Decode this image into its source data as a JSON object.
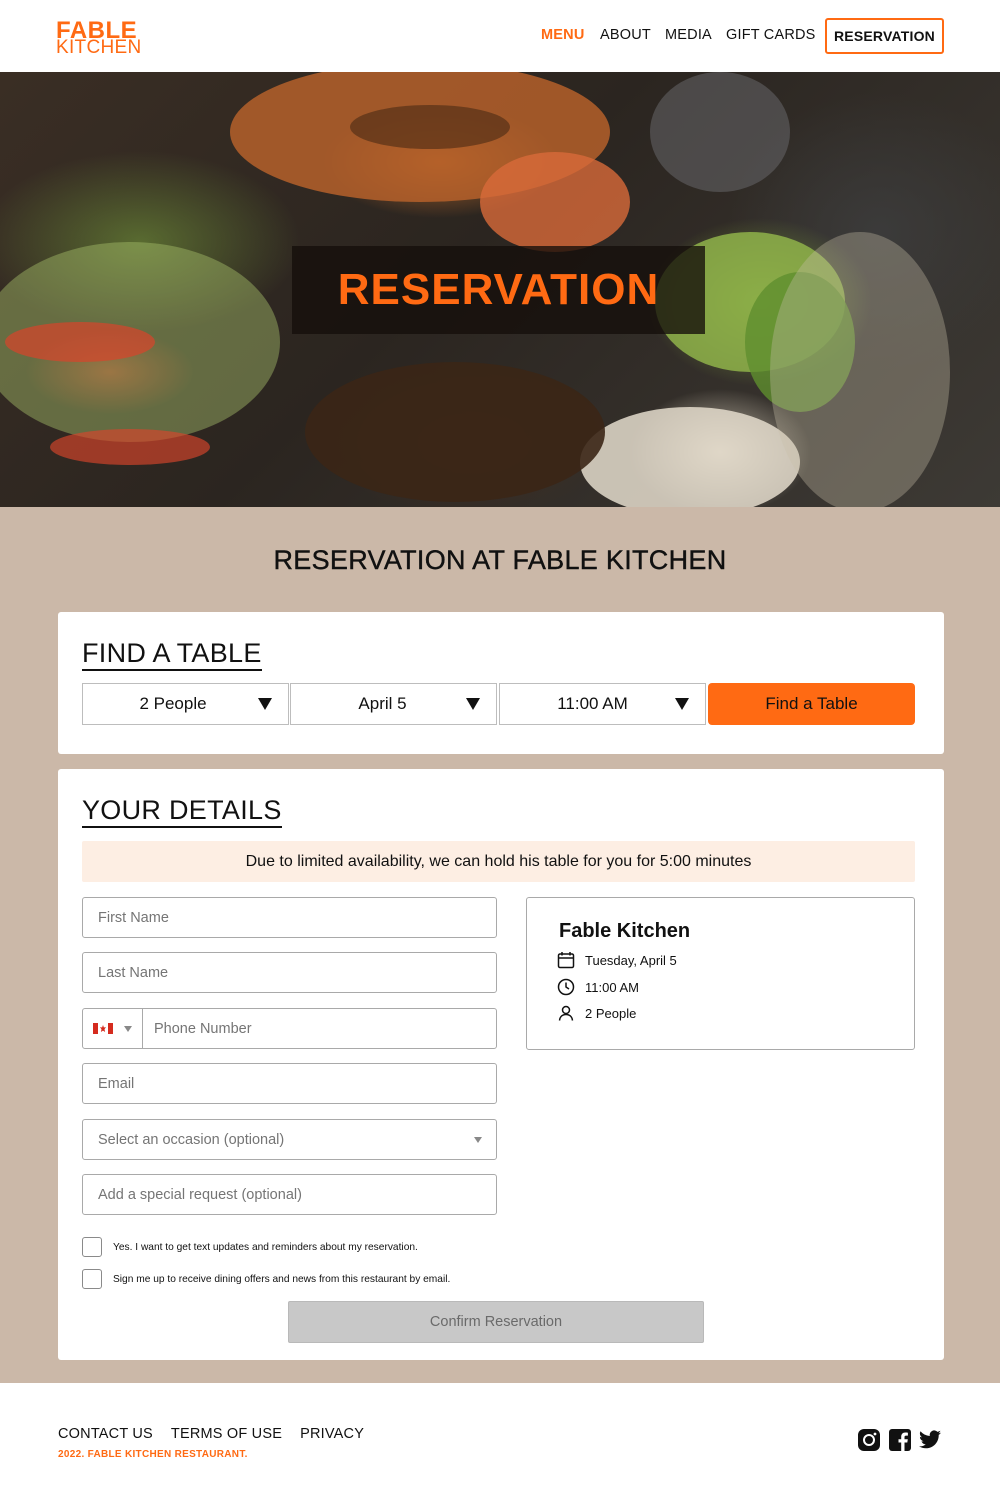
{
  "brand": {
    "line1": "FABLE",
    "line2": "KITCHEN",
    "accent_color": "#ff6a13"
  },
  "nav": {
    "items": [
      {
        "label": "MENU",
        "active": true
      },
      {
        "label": "ABOUT",
        "active": false
      },
      {
        "label": "MEDIA",
        "active": false
      },
      {
        "label": "GIFT CARDS",
        "active": false
      }
    ],
    "reservation_button": "RESERVATION"
  },
  "hero": {
    "title": "RESERVATION"
  },
  "page": {
    "title": "RESERVATION AT FABLE KITCHEN",
    "background": "#cbb8a8"
  },
  "find_table": {
    "heading": "FIND A TABLE",
    "party_size": "2 People",
    "date": "April 5",
    "time": "11:00 AM",
    "button": "Find a Table"
  },
  "details": {
    "heading": "YOUR DETAILS",
    "notice": "Due to limited availability, we can hold his table for you for 5:00 minutes",
    "fields": {
      "first_name": {
        "placeholder": "First Name",
        "value": ""
      },
      "last_name": {
        "placeholder": "Last Name",
        "value": ""
      },
      "phone": {
        "placeholder": "Phone Number",
        "value": "",
        "country_flag": "canada-flag-icon"
      },
      "email": {
        "placeholder": "Email",
        "value": ""
      },
      "occasion": {
        "placeholder": "Select an occasion (optional)"
      },
      "special_request": {
        "placeholder": "Add a special request (optional)",
        "value": ""
      }
    },
    "checkboxes": [
      {
        "label": "Yes. I want to get text updates and reminders about my reservation.",
        "checked": false
      },
      {
        "label": "Sign me up to receive dining offers and news from this restaurant by email.",
        "checked": false
      }
    ],
    "confirm_button": "Confirm Reservation",
    "summary": {
      "restaurant": "Fable Kitchen",
      "date": "Tuesday, April 5",
      "time": "11:00 AM",
      "party": "2 People",
      "icons": [
        "calendar-icon",
        "clock-icon",
        "person-icon"
      ]
    }
  },
  "footer": {
    "links": [
      "CONTACT US",
      "TERMS OF USE",
      "PRIVACY"
    ],
    "copyright": "2022. FABLE KITCHEN RESTAURANT.",
    "social_icons": [
      "instagram-icon",
      "facebook-icon",
      "twitter-icon"
    ]
  }
}
